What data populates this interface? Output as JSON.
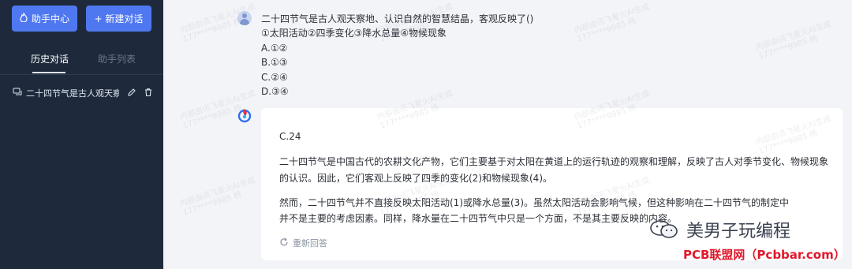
{
  "sidebar": {
    "helper_center_button": "助手中心",
    "new_chat_button": "+ 新建对话",
    "tabs": [
      "历史对话",
      "助手列表"
    ],
    "history": [
      {
        "title": "二十四节气是古人观天察地、认识自然的智慧结晶，客观反映了"
      }
    ]
  },
  "question": {
    "lines": [
      "二十四节气是古人观天察地、认识自然的智慧结晶，客观反映了()",
      "①太阳活动②四季变化③降水总量④物候现象",
      "A.①②",
      "B.①③",
      "C.②④",
      "D.③④"
    ]
  },
  "answer": {
    "paragraphs": [
      "C.24",
      "二十四节气是中国古代的农耕文化产物，它们主要基于对太阳在黄道上的运行轨迹的观察和理解，反映了古人对季节变化、物候现象的认识。因此，它们客观上反映了四季的变化(2)和物候现象(4)。",
      "然而，二十四节气并不直接反映太阳活动(1)或降水总量(3)。虽然太阳活动会影响气候，但这种影响在二十四节气的制定中",
      "并不是主要的考虑因素。同样，降水量在二十四节气中只是一个方面，不是其主要反映的内容。"
    ],
    "regenerate": "重新回答"
  },
  "watermark": {
    "text": "内部由讯飞星火AI生成",
    "id": "177****9985 杨"
  },
  "branding": {
    "wechat_name": "美男子玩编程",
    "site": "PCB联盟网（Pcbbar.com）"
  }
}
